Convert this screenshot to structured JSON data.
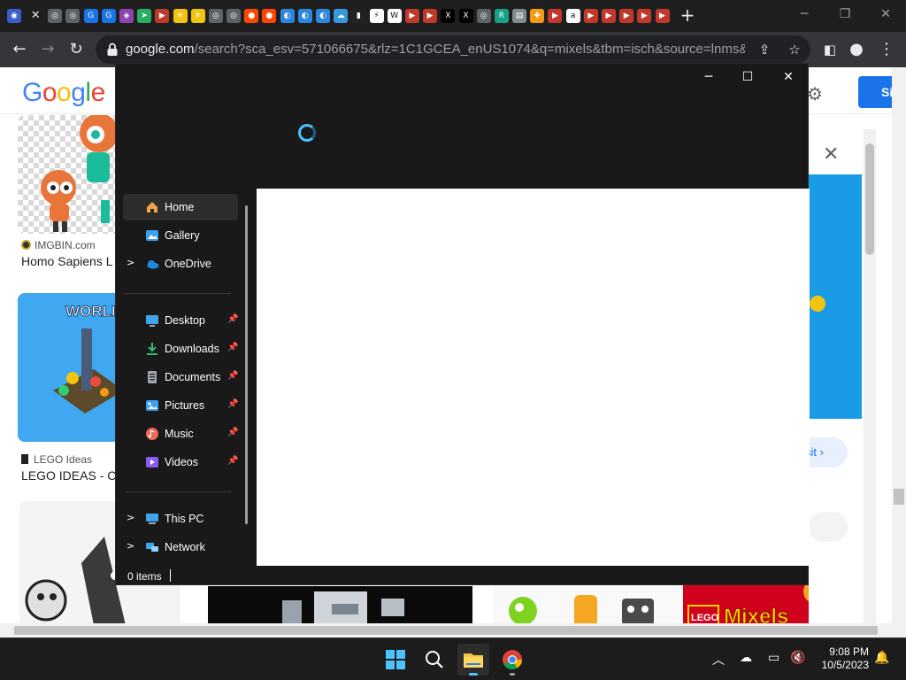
{
  "browser": {
    "tab_icons": [
      {
        "name": "tab-favicon-firefox",
        "color": "#3a5ccc",
        "glyph": "◉"
      },
      {
        "name": "tab-favicon-chrome",
        "color": "#5f6368",
        "glyph": "◎"
      },
      {
        "name": "tab-favicon-chrome-2",
        "color": "#5f6368",
        "glyph": "◎"
      },
      {
        "name": "tab-favicon-gif",
        "color": "#1a73e8",
        "glyph": "G"
      },
      {
        "name": "tab-favicon-gif-2",
        "color": "#1a73e8",
        "glyph": "G"
      },
      {
        "name": "tab-favicon-purple",
        "color": "#8e44ad",
        "glyph": "◈"
      },
      {
        "name": "tab-favicon-arrow",
        "color": "#27ae60",
        "glyph": "➤"
      },
      {
        "name": "tab-favicon-play",
        "color": "#c0392b",
        "glyph": "▶"
      },
      {
        "name": "tab-favicon-walmart",
        "color": "#f1c40f",
        "glyph": "✳"
      },
      {
        "name": "tab-favicon-walmart-2",
        "color": "#f1c40f",
        "glyph": "✳"
      },
      {
        "name": "tab-favicon-chrome-3",
        "color": "#5f6368",
        "glyph": "◎"
      },
      {
        "name": "tab-favicon-chrome-4",
        "color": "#5f6368",
        "glyph": "◎"
      },
      {
        "name": "tab-favicon-reddit",
        "color": "#ff4500",
        "glyph": "●"
      },
      {
        "name": "tab-favicon-reddit-2",
        "color": "#ff4500",
        "glyph": "●"
      },
      {
        "name": "tab-favicon-edge",
        "color": "#2e86de",
        "glyph": "◐"
      },
      {
        "name": "tab-favicon-edge-2",
        "color": "#2e86de",
        "glyph": "◐"
      },
      {
        "name": "tab-favicon-edge-3",
        "color": "#2e86de",
        "glyph": "◐"
      },
      {
        "name": "tab-favicon-cloud",
        "color": "#3498db",
        "glyph": "☁"
      },
      {
        "name": "tab-favicon-lego",
        "color": "#222222",
        "glyph": "▮"
      },
      {
        "name": "tab-favicon-bolt",
        "color": "#ffffff",
        "glyph": "⚡"
      },
      {
        "name": "tab-favicon-wikipedia",
        "color": "#ffffff",
        "glyph": "W"
      },
      {
        "name": "tab-favicon-play-2",
        "color": "#c0392b",
        "glyph": "▶"
      },
      {
        "name": "tab-favicon-play-3",
        "color": "#c0392b",
        "glyph": "▶"
      },
      {
        "name": "tab-favicon-x",
        "color": "#000000",
        "glyph": "X"
      },
      {
        "name": "tab-favicon-x-2",
        "color": "#000000",
        "glyph": "X"
      },
      {
        "name": "tab-favicon-chrome-5",
        "color": "#5f6368",
        "glyph": "◎"
      },
      {
        "name": "tab-favicon-green",
        "color": "#16a085",
        "glyph": "R"
      },
      {
        "name": "tab-favicon-bag",
        "color": "#7f8c8d",
        "glyph": "▤"
      },
      {
        "name": "tab-favicon-puzzle",
        "color": "#f39c12",
        "glyph": "✚"
      },
      {
        "name": "tab-favicon-play-4",
        "color": "#c0392b",
        "glyph": "▶"
      },
      {
        "name": "tab-favicon-amazon",
        "color": "#ffffff",
        "glyph": "a"
      },
      {
        "name": "tab-favicon-play-5",
        "color": "#c0392b",
        "glyph": "▶"
      },
      {
        "name": "tab-favicon-play-6",
        "color": "#c0392b",
        "glyph": "▶"
      },
      {
        "name": "tab-favicon-play-7",
        "color": "#c0392b",
        "glyph": "▶"
      },
      {
        "name": "tab-favicon-play-8",
        "color": "#c0392b",
        "glyph": "▶"
      },
      {
        "name": "tab-favicon-play-9",
        "color": "#c0392b",
        "glyph": "▶"
      }
    ],
    "url_host": "google.com",
    "url_path": "/search?sca_esv=571066675&rlz=1C1GCEA_enUS1074&q=mixels&tbm=isch&source=lnms&sa=X&..."
  },
  "page": {
    "logo_letters": [
      {
        "ch": "G",
        "color": "#4285f4"
      },
      {
        "ch": "o",
        "color": "#ea4335"
      },
      {
        "ch": "o",
        "color": "#fbbc05"
      },
      {
        "ch": "g",
        "color": "#4285f4"
      },
      {
        "ch": "l",
        "color": "#34a853"
      },
      {
        "ch": "e",
        "color": "#ea4335"
      }
    ],
    "signin_label": "Si",
    "results": [
      {
        "source": "IMGBIN.com",
        "title": "Homo Sapiens L"
      },
      {
        "source": "LEGO Ideas",
        "title": "LEGO IDEAS - Ce"
      }
    ],
    "thumb_text_world": "WORLI",
    "thumb_text_lego": "LEGO",
    "thumb_text_mixels": "Mixels",
    "side_visit": "sit"
  },
  "explorer": {
    "nav": [
      {
        "label": "Home",
        "icon": "home",
        "color": "#f0a44b",
        "chevron": false,
        "pinned": false,
        "selected": true
      },
      {
        "label": "Gallery",
        "icon": "gallery",
        "color": "#3aa0f0",
        "chevron": false,
        "pinned": false,
        "selected": false
      },
      {
        "label": "OneDrive",
        "icon": "onedrive",
        "color": "#1e88e5",
        "chevron": true,
        "pinned": false,
        "selected": false
      },
      {
        "label": "Desktop",
        "icon": "desktop",
        "color": "#41a5ee",
        "chevron": false,
        "pinned": true,
        "selected": false
      },
      {
        "label": "Downloads",
        "icon": "downloads",
        "color": "#2fbf71",
        "chevron": false,
        "pinned": true,
        "selected": false
      },
      {
        "label": "Documents",
        "icon": "documents",
        "color": "#9aa6b2",
        "chevron": false,
        "pinned": true,
        "selected": false
      },
      {
        "label": "Pictures",
        "icon": "pictures",
        "color": "#3aa0f0",
        "chevron": false,
        "pinned": true,
        "selected": false
      },
      {
        "label": "Music",
        "icon": "music",
        "color": "#ee6a5a",
        "chevron": false,
        "pinned": true,
        "selected": false
      },
      {
        "label": "Videos",
        "icon": "videos",
        "color": "#8a5cf5",
        "chevron": false,
        "pinned": true,
        "selected": false
      },
      {
        "label": "This PC",
        "icon": "this-pc",
        "color": "#41a5ee",
        "chevron": true,
        "pinned": false,
        "selected": false
      },
      {
        "label": "Network",
        "icon": "network",
        "color": "#41a5ee",
        "chevron": true,
        "pinned": false,
        "selected": false
      }
    ],
    "status": "0 items",
    "accent": "#4cc2ff"
  },
  "taskbar": {
    "time": "9:08 PM",
    "date": "10/5/2023"
  }
}
